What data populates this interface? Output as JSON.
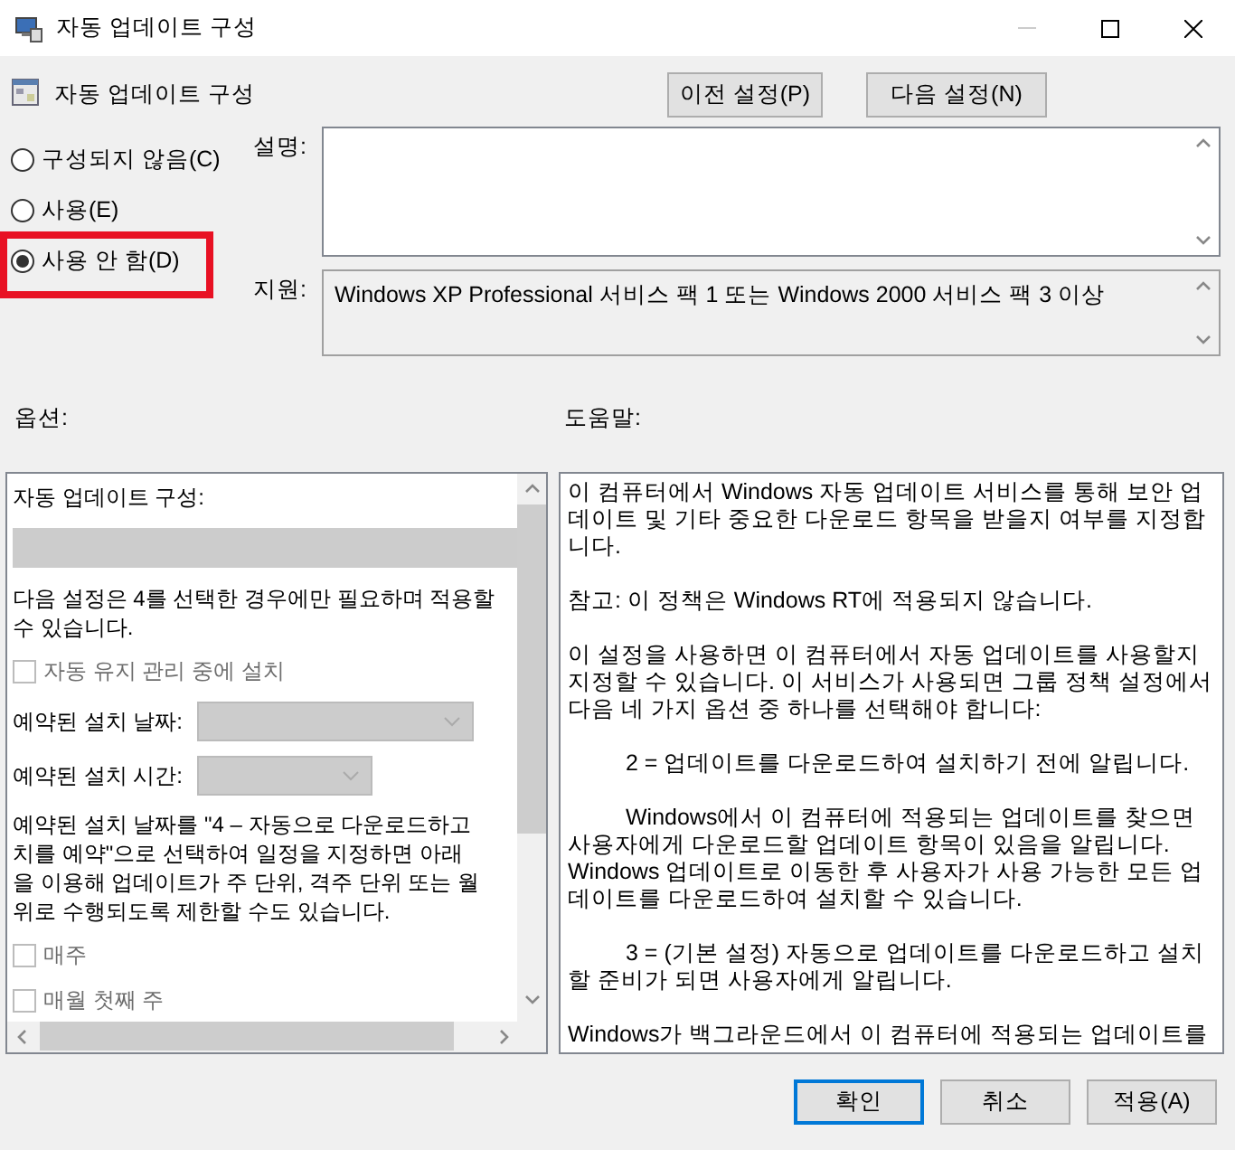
{
  "window": {
    "title": "자동 업데이트 구성"
  },
  "header": {
    "title": "자동 업데이트 구성",
    "buttons": [
      {
        "label": "이전 설정(P)"
      },
      {
        "label": "다음 설정(N)"
      }
    ]
  },
  "state_options": [
    {
      "label": "구성되지 않음(C)",
      "selected": false,
      "highlighted": false
    },
    {
      "label": "사용(E)",
      "selected": false,
      "highlighted": false
    },
    {
      "label": "사용 안 함(D)",
      "selected": true,
      "highlighted": true
    }
  ],
  "comment": {
    "label": "설명:"
  },
  "supported": {
    "label": "지원:",
    "value": "Windows XP Professional 서비스 팩 1 또는 Windows 2000 서비스 팩 3 이상"
  },
  "options": {
    "label": "옵션:",
    "items": [
      {
        "kind": "text",
        "lines": [
          "자동 업데이트 구성:"
        ]
      },
      {
        "kind": "combo",
        "disabled": true
      },
      {
        "kind": "text",
        "lines": [
          "다음 설정은 4를 선택한 경우에만 필요하며 적용할",
          "수 있습니다."
        ]
      },
      {
        "kind": "checkbox",
        "label": "자동 유지 관리 중에 설치",
        "checked": false,
        "disabled": true
      },
      {
        "kind": "labeled-combo",
        "label": "예약된 설치 날짜:",
        "disabled": true
      },
      {
        "kind": "labeled-combo",
        "label": "예약된 설치 시간:",
        "disabled": true
      },
      {
        "kind": "text",
        "lines": [
          "예약된 설치 날짜를 \"4 – 자동으로 다운로드하고",
          "치를 예약\"으로 선택하여 일정을 지정하면 아래",
          "을 이용해 업데이트가 주 단위, 격주 단위 또는 월",
          "위로 수행되도록 제한할 수도 있습니다."
        ]
      },
      {
        "kind": "checkbox",
        "label": "매주",
        "checked": false,
        "disabled": true
      },
      {
        "kind": "checkbox",
        "label": "매월 첫째 주",
        "checked": false,
        "disabled": true
      }
    ]
  },
  "help": {
    "label": "도움말:",
    "paragraphs": [
      {
        "text": "이 컴퓨터에서 Windows 자동 업데이트 서비스를 통해 보안 업데이트 및 기타 중요한 다운로드 항목을 받을지 여부를 지정합니다.",
        "indented": false
      },
      {
        "text": "참고: 이 정책은 Windows RT에 적용되지 않습니다.",
        "indented": false
      },
      {
        "text": "이 설정을 사용하면 이 컴퓨터에서 자동 업데이트를 사용할지 지정할 수 있습니다. 이 서비스가 사용되면 그룹 정책 설정에서 다음 네 가지 옵션 중 하나를 선택해야 합니다:",
        "indented": false
      },
      {
        "text": "2 = 업데이트를 다운로드하여 설치하기 전에 알립니다.",
        "indented": true
      },
      {
        "text": "Windows에서 이 컴퓨터에 적용되는 업데이트를 찾으면 사용자에게 다운로드할 업데이트 항목이 있음을 알립니다. Windows 업데이트로 이동한 후 사용자가 사용 가능한 모든 업데이트를 다운로드하여 설치할 수 있습니다.",
        "indented": true
      },
      {
        "text": "3 = (기본 설정) 자동으로 업데이트를 다운로드하고 설치할 준비가 되면 사용자에게 알립니다.",
        "indented": true
      },
      {
        "text": "Windows가 백그라운드에서 이 컴퓨터에 적용되는 업데이트를",
        "indented": false
      }
    ]
  },
  "footer": {
    "buttons": [
      {
        "label": "확인",
        "default": true
      },
      {
        "label": "취소",
        "default": false
      },
      {
        "label": "적용(A)",
        "default": false
      }
    ]
  }
}
